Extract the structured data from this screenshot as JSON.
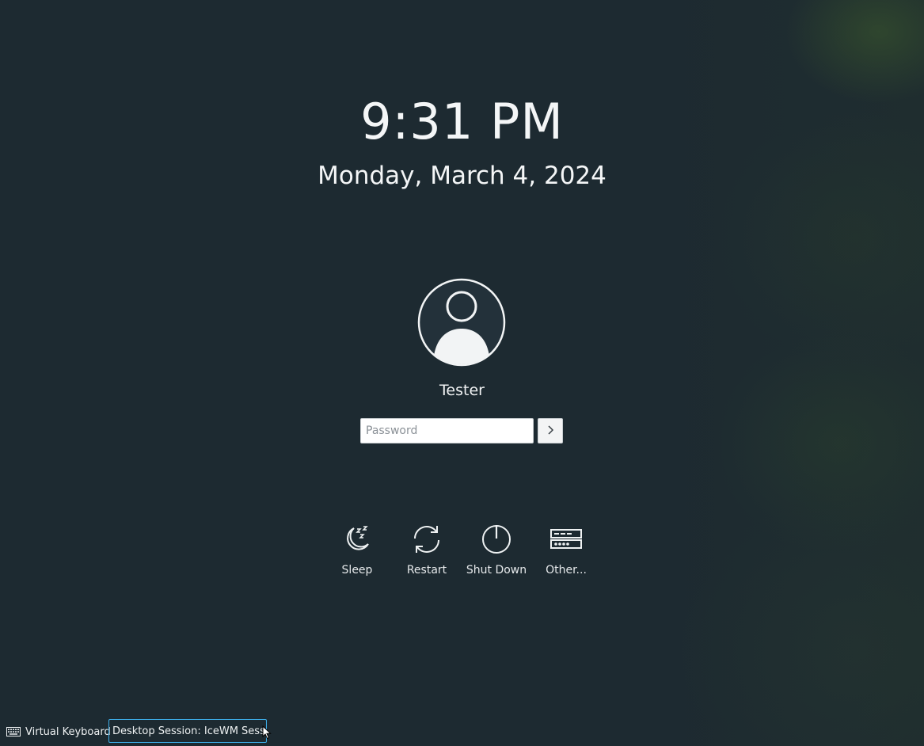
{
  "clock": {
    "time": "9:31 PM",
    "date": "Monday, March 4, 2024"
  },
  "user": {
    "avatar_icon": "user-avatar-icon",
    "name": "Tester"
  },
  "login": {
    "password_placeholder": "Password",
    "password_value": "",
    "submit_icon": "chevron-right-icon"
  },
  "actions": [
    {
      "label": "Sleep",
      "icon": "sleep-moon-icon"
    },
    {
      "label": "Restart",
      "icon": "restart-icon"
    },
    {
      "label": "Shut Down",
      "icon": "power-icon"
    },
    {
      "label": "Other...",
      "icon": "switch-user-icon"
    }
  ],
  "footer": {
    "virtual_keyboard_label": "Virtual Keyboard",
    "virtual_keyboard_icon": "keyboard-icon",
    "session_label": "Desktop Session: IceWM Session"
  },
  "colors": {
    "background": "#1d2a31",
    "text": "#eef1f2",
    "focus_accent": "#3daee9"
  }
}
